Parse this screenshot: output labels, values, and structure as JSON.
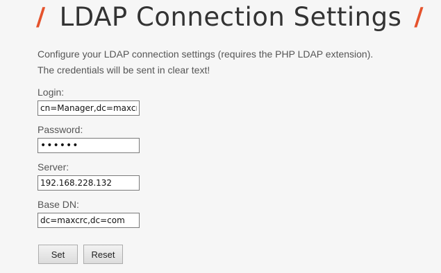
{
  "header": {
    "title": "LDAP Connection Settings",
    "slash_left": "/",
    "slash_right": "/",
    "accent_color": "#e5532d"
  },
  "description": {
    "line1": "Configure your LDAP connection settings (requires the PHP LDAP extension).",
    "line2": "The credentials will be sent in clear text!"
  },
  "form": {
    "login": {
      "label": "Login:",
      "value": "cn=Manager,dc=maxcrc,dc=com"
    },
    "password": {
      "label": "Password:",
      "value": "secret"
    },
    "server": {
      "label": "Server:",
      "value": "192.168.228.132"
    },
    "base_dn": {
      "label": "Base DN:",
      "value": "dc=maxcrc,dc=com"
    }
  },
  "buttons": {
    "set_label": "Set",
    "reset_label": "Reset"
  }
}
